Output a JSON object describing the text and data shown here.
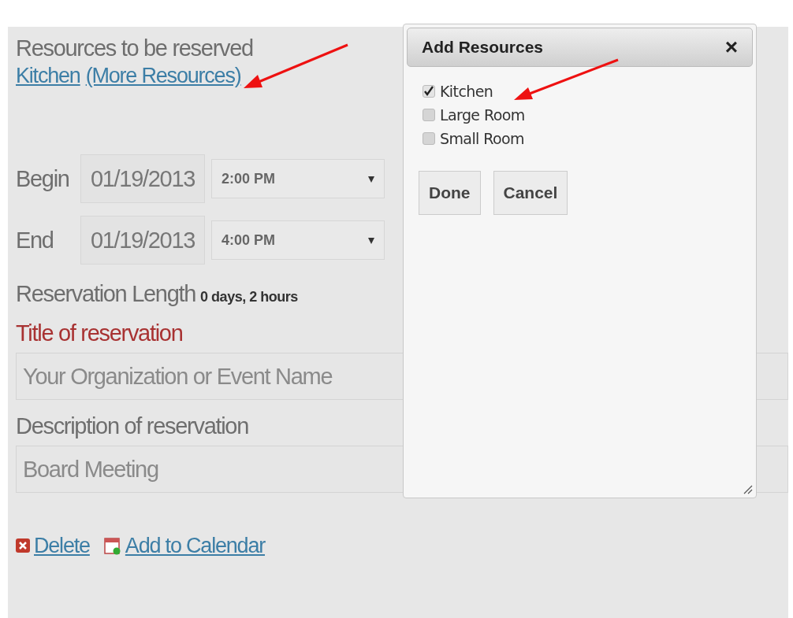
{
  "resources": {
    "label": "Resources to be reserved",
    "links": [
      {
        "text": "Kitchen"
      },
      {
        "text": "(More Resources)"
      }
    ]
  },
  "times": [
    {
      "label": "Begin",
      "date": "01/19/2013",
      "time": "2:00 PM"
    },
    {
      "label": "End",
      "date": "01/19/2013",
      "time": "4:00 PM"
    }
  ],
  "length": {
    "label": "Reservation Length",
    "value": "0 days, 2 hours"
  },
  "title_field": {
    "label": "Title of reservation",
    "placeholder": "Your Organization or Event Name"
  },
  "description_field": {
    "label": "Description of reservation",
    "value": "Board Meeting"
  },
  "actions": [
    {
      "kind": "delete",
      "text": "Delete"
    },
    {
      "kind": "calendar",
      "text": "Add to Calendar"
    }
  ],
  "dialog": {
    "title": "Add Resources",
    "close": "×",
    "options": [
      {
        "label": "Kitchen",
        "checked": true
      },
      {
        "label": "Large Room",
        "checked": false
      },
      {
        "label": "Small Room",
        "checked": false
      }
    ],
    "buttons": [
      "Done",
      "Cancel"
    ]
  }
}
